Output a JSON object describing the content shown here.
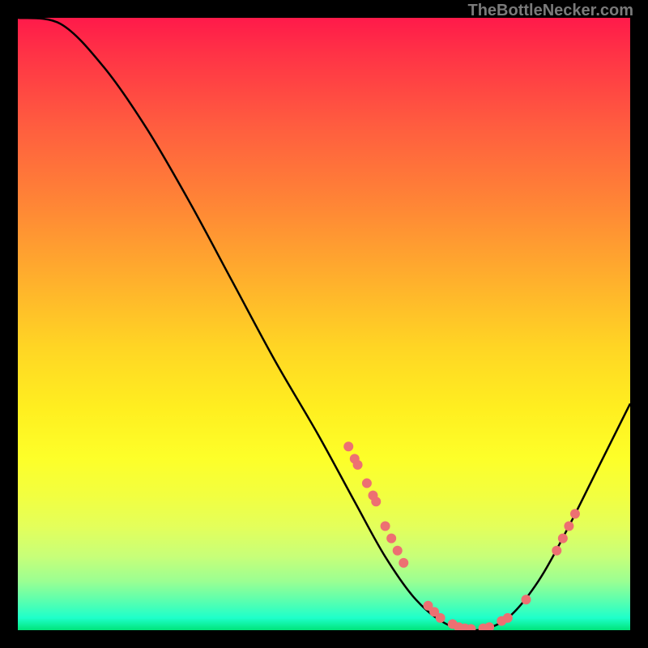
{
  "watermark": "TheBottleNecker.com",
  "chart_data": {
    "type": "line",
    "title": "",
    "xlabel": "",
    "ylabel": "",
    "xlim": [
      0,
      100
    ],
    "ylim": [
      0,
      100
    ],
    "curve": [
      {
        "x": 0,
        "y": 100
      },
      {
        "x": 7,
        "y": 99
      },
      {
        "x": 14,
        "y": 92
      },
      {
        "x": 21,
        "y": 82
      },
      {
        "x": 28,
        "y": 70
      },
      {
        "x": 35,
        "y": 57
      },
      {
        "x": 42,
        "y": 44
      },
      {
        "x": 49,
        "y": 32
      },
      {
        "x": 55,
        "y": 21
      },
      {
        "x": 60,
        "y": 12
      },
      {
        "x": 65,
        "y": 5
      },
      {
        "x": 70,
        "y": 1
      },
      {
        "x": 75,
        "y": 0
      },
      {
        "x": 80,
        "y": 2
      },
      {
        "x": 85,
        "y": 8
      },
      {
        "x": 90,
        "y": 17
      },
      {
        "x": 95,
        "y": 27
      },
      {
        "x": 100,
        "y": 37
      }
    ],
    "markers": [
      {
        "x": 54,
        "y": 30
      },
      {
        "x": 55,
        "y": 28
      },
      {
        "x": 55.5,
        "y": 27
      },
      {
        "x": 57,
        "y": 24
      },
      {
        "x": 58,
        "y": 22
      },
      {
        "x": 58.5,
        "y": 21
      },
      {
        "x": 60,
        "y": 17
      },
      {
        "x": 61,
        "y": 15
      },
      {
        "x": 62,
        "y": 13
      },
      {
        "x": 63,
        "y": 11
      },
      {
        "x": 67,
        "y": 4
      },
      {
        "x": 68,
        "y": 3
      },
      {
        "x": 69,
        "y": 2
      },
      {
        "x": 71,
        "y": 1
      },
      {
        "x": 72,
        "y": 0.5
      },
      {
        "x": 73,
        "y": 0.3
      },
      {
        "x": 74,
        "y": 0.2
      },
      {
        "x": 76,
        "y": 0.3
      },
      {
        "x": 77,
        "y": 0.5
      },
      {
        "x": 79,
        "y": 1.5
      },
      {
        "x": 80,
        "y": 2
      },
      {
        "x": 83,
        "y": 5
      },
      {
        "x": 88,
        "y": 13
      },
      {
        "x": 89,
        "y": 15
      },
      {
        "x": 90,
        "y": 17
      },
      {
        "x": 91,
        "y": 19
      }
    ],
    "marker_color": "#ed7072",
    "curve_color": "#000000"
  }
}
